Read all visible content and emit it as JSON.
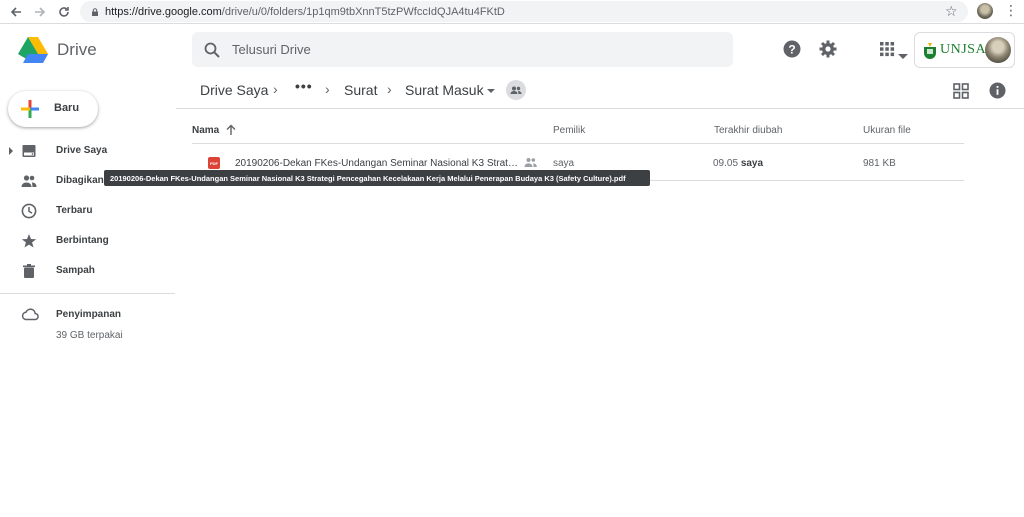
{
  "browser": {
    "url_host": "https://drive.google.com",
    "url_path": "/drive/u/0/folders/1p1qm9tbXnnT5tzPWfccIdQJA4tu4FKtD"
  },
  "header": {
    "app_name": "Drive",
    "search_placeholder": "Telusuri Drive",
    "account_org": "UNJSA"
  },
  "breadcrumb": {
    "root": "Drive Saya",
    "ellipsis": "•••",
    "parent": "Surat",
    "current": "Surat Masuk"
  },
  "sidebar": {
    "new_label": "Baru",
    "items": [
      {
        "label": "Drive Saya",
        "icon": "drive-icon"
      },
      {
        "label": "Dibagikan",
        "icon": "people-icon"
      },
      {
        "label": "Terbaru",
        "icon": "clock-icon"
      },
      {
        "label": "Berbintang",
        "icon": "star-icon"
      },
      {
        "label": "Sampah",
        "icon": "trash-icon"
      }
    ],
    "storage_label": "Penyimpanan",
    "storage_used": "39 GB terpakai"
  },
  "list": {
    "columns": {
      "name": "Nama",
      "owner": "Pemilik",
      "modified": "Terakhir diubah",
      "size": "Ukuran file"
    },
    "files": [
      {
        "name": "20190206-Dekan FKes-Undangan Seminar Nasional K3 Strateg…",
        "owner": "saya",
        "modified_time": "09.05",
        "modified_by": "saya",
        "size": "981 KB",
        "type": "PDF"
      }
    ]
  },
  "tooltip": {
    "text": "20190206-Dekan FKes-Undangan Seminar Nasional K3 Strategi Pencegahan Kecelakaan Kerja Melalui Penerapan Budaya K3 (Safety Culture).pdf"
  },
  "colors": {
    "accent_blue": "#1a73e8",
    "pdf_red": "#db4437",
    "unjsa_green": "#1a7f2e"
  }
}
